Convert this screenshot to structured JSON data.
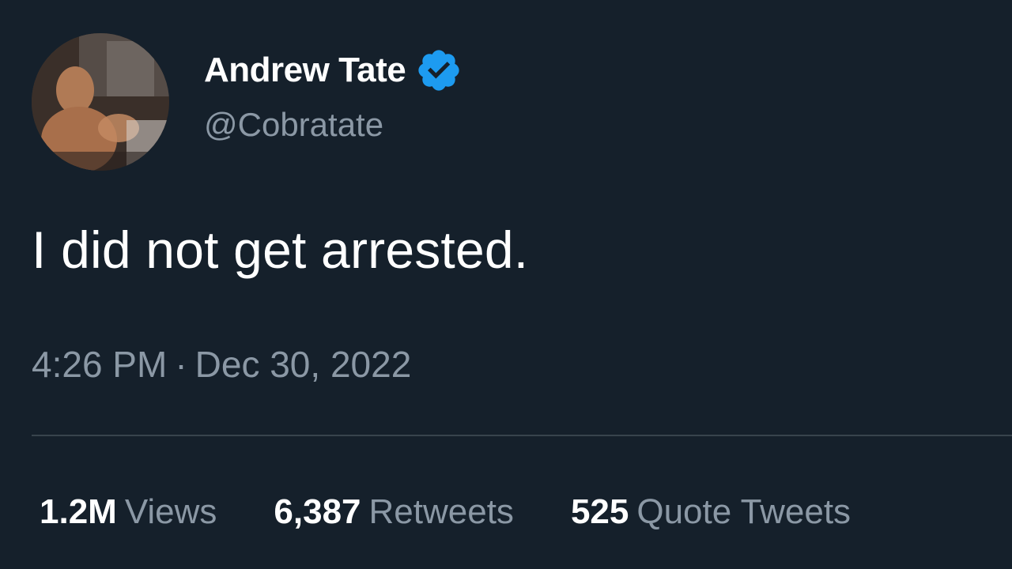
{
  "tweet": {
    "author": {
      "display_name": "Andrew Tate",
      "handle": "@Cobratate",
      "verified": true,
      "avatar_icon": "profile-photo"
    },
    "text": "I did not get arrested.",
    "time": "4:26 PM",
    "separator": "·",
    "date": "Dec 30, 2022",
    "stats": {
      "views_count": "1.2M",
      "views_label": "Views",
      "retweets_count": "6,387",
      "retweets_label": "Retweets",
      "quotes_count": "525",
      "quotes_label": "Quote Tweets"
    }
  },
  "colors": {
    "background": "#15202b",
    "primary_text": "#ffffff",
    "secondary_text": "#8b98a5",
    "verified_badge": "#1d9bf0",
    "divider": "#38444d"
  }
}
